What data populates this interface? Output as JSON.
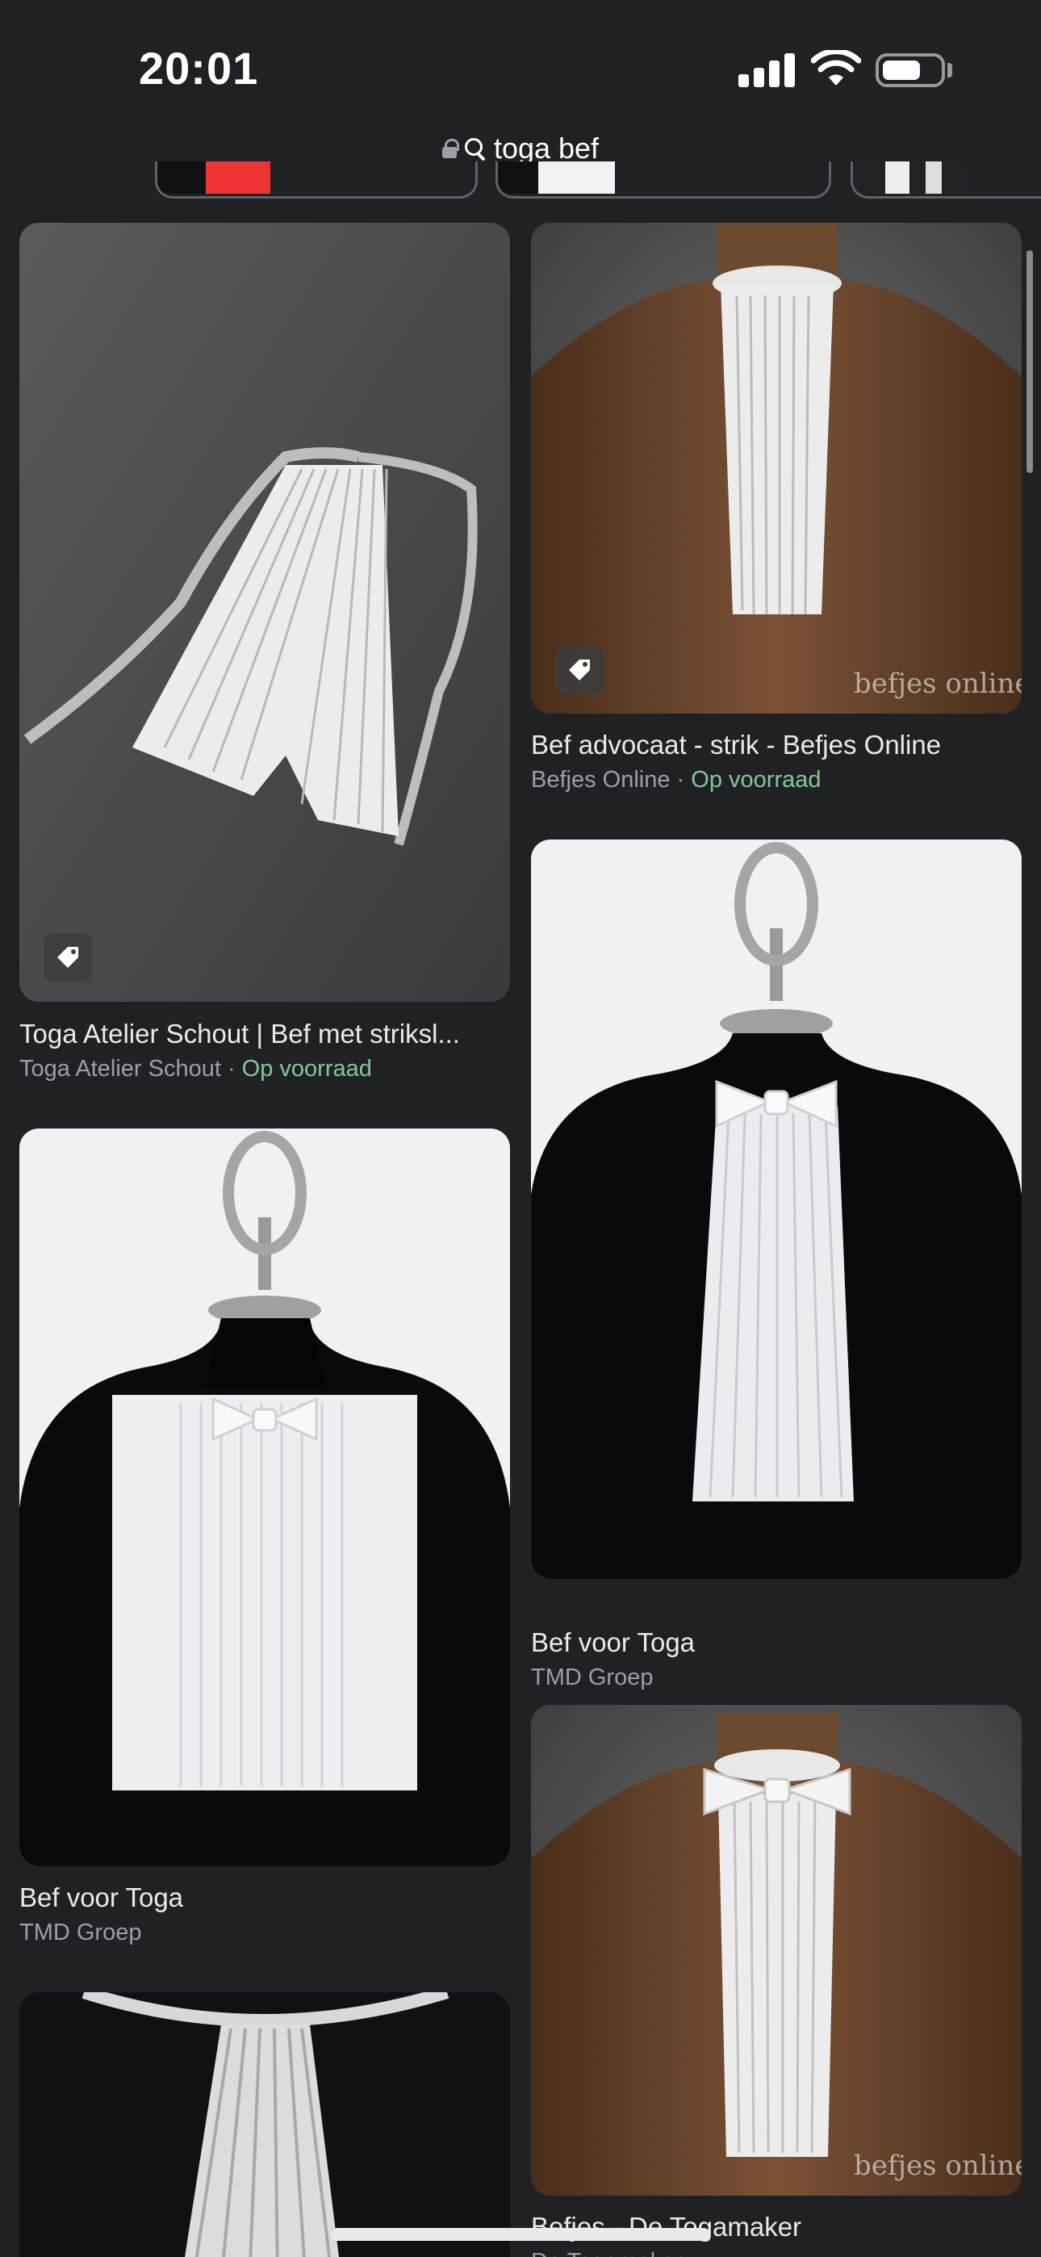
{
  "status_bar": {
    "time": "20:01"
  },
  "url_bar": {
    "query": "toga bef"
  },
  "results": [
    {
      "title": "Toga Atelier Schout | Bef met striksl...",
      "source": "Toga Atelier Schout",
      "separator": " · ",
      "stock": "Op voorraad"
    },
    {
      "title": "Bef advocaat - strik - Befjes Online",
      "source": "Befjes Online",
      "separator": " · ",
      "stock": "Op voorraad",
      "watermark": "befjes online"
    },
    {
      "title": "Bef voor Toga",
      "source": "TMD Groep"
    },
    {
      "title": "Bef voor Toga",
      "source": "TMD Groep"
    },
    {
      "title": "Befjes - De Togamaker",
      "source": "De Togamaker",
      "watermark": "befjes online"
    }
  ],
  "colors": {
    "background": "#202124",
    "in_stock": "#81c995",
    "secondary_text": "#9aa0a6"
  }
}
